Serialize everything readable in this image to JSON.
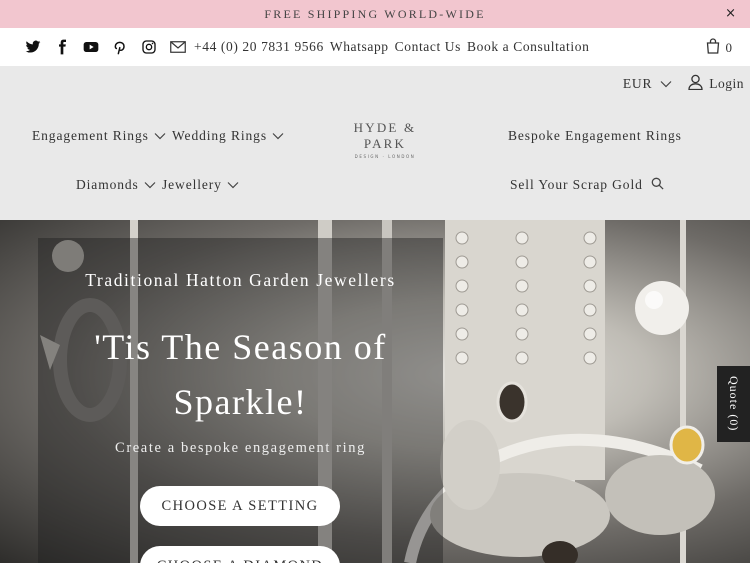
{
  "promo": {
    "text": "FREE SHIPPING WORLD-WIDE",
    "close": "×"
  },
  "contact": {
    "social_icons": [
      "twitter-icon",
      "facebook-icon",
      "youtube-icon",
      "pinterest-icon",
      "instagram-icon"
    ],
    "phone": "+44 (0) 20 7831 9566",
    "whatsapp": "Whatsapp",
    "contact_us": "Contact Us",
    "consultation": "Book a Consultation"
  },
  "cart": {
    "count": "0"
  },
  "utility": {
    "currency": "EUR",
    "login": "Login"
  },
  "nav": {
    "engagement_rings": "Engagement Rings",
    "wedding_rings": "Wedding Rings",
    "diamonds": "Diamonds",
    "jewellery": "Jewellery",
    "bespoke": "Bespoke Engagement Rings",
    "scrap_gold": "Sell Your Scrap Gold",
    "logo_main": "HYDE & PARK",
    "logo_sub": "DESIGN · LONDON"
  },
  "hero": {
    "eyebrow": "Traditional Hatton Garden Jewellers",
    "headline": "'Tis The Season of Sparkle!",
    "subline": "Create a bespoke engagement ring",
    "btn_setting": "CHOOSE A SETTING",
    "btn_diamond": "CHOOSE A DIAMOND"
  },
  "quote": {
    "label": "Quote (0)"
  },
  "colors": {
    "promo_bg": "#f2c6cf",
    "nav_bg": "#e9e9e9",
    "text": "#333333"
  }
}
